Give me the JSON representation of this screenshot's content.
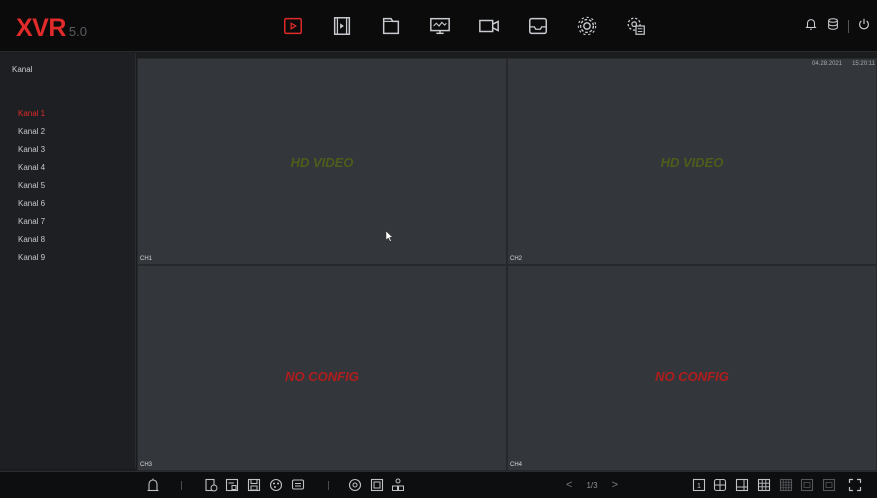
{
  "logo": {
    "main": "XVR",
    "version": "5.0"
  },
  "nav": {
    "items": [
      {
        "name": "playback-icon",
        "active": true
      },
      {
        "name": "film-clip-icon",
        "active": false
      },
      {
        "name": "folder-icon",
        "active": false
      },
      {
        "name": "monitor-icon",
        "active": false
      },
      {
        "name": "camera-icon",
        "active": false
      },
      {
        "name": "storage-tray-icon",
        "active": false
      },
      {
        "name": "gear-icon",
        "active": false
      },
      {
        "name": "system-settings-icon",
        "active": false
      }
    ]
  },
  "top_right": {
    "icons": [
      "bell-icon",
      "disk-icon",
      "power-icon"
    ]
  },
  "sidebar": {
    "title": "Kanal",
    "channels": [
      {
        "label": "Kanal 1",
        "active": true
      },
      {
        "label": "Kanal 2",
        "active": false
      },
      {
        "label": "Kanal 3",
        "active": false
      },
      {
        "label": "Kanal 4",
        "active": false
      },
      {
        "label": "Kanal 5",
        "active": false
      },
      {
        "label": "Kanal 6",
        "active": false
      },
      {
        "label": "Kanal 7",
        "active": false
      },
      {
        "label": "Kanal 8",
        "active": false
      },
      {
        "label": "Kanal 9",
        "active": false
      }
    ]
  },
  "overlay": {
    "date": "04.28.2021",
    "time": "15:20:11"
  },
  "tiles": [
    {
      "message": "HD VIDEO",
      "channel": "CH1",
      "kind": "video"
    },
    {
      "message": "HD VIDEO",
      "channel": "CH2",
      "kind": "video"
    },
    {
      "message": "NO CONFIG",
      "channel": "CH3",
      "kind": "noconfig"
    },
    {
      "message": "NO CONFIG",
      "channel": "CH4",
      "kind": "noconfig"
    }
  ],
  "pager": {
    "prev": "<",
    "page": "1/3",
    "next": ">"
  },
  "colors": {
    "accent": "#e12a2a",
    "video_text": "#4e5d1a",
    "noconfig_text": "#b01d1d",
    "tile_bg": "#33363a"
  }
}
